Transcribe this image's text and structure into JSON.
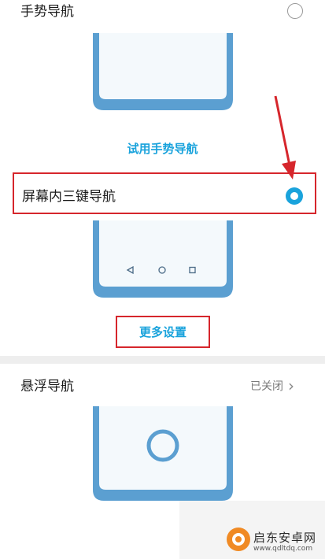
{
  "gesture": {
    "title": "手势导航",
    "try_link": "试用手势导航"
  },
  "three_key": {
    "title": "屏幕内三键导航",
    "more_settings": "更多设置",
    "nav_icons": [
      "back-triangle-icon",
      "home-circle-icon",
      "recents-square-icon"
    ]
  },
  "floating": {
    "title": "悬浮导航",
    "status": "已关闭",
    "chevron": "›"
  },
  "watermark": {
    "brand": "启东安卓网",
    "url": "www.qdltdq.com"
  },
  "colors": {
    "accent": "#1aa3dc",
    "highlight_red": "#d6262c",
    "phone_frame": "#5b9fd1",
    "phone_screen": "#f4f9fc"
  }
}
